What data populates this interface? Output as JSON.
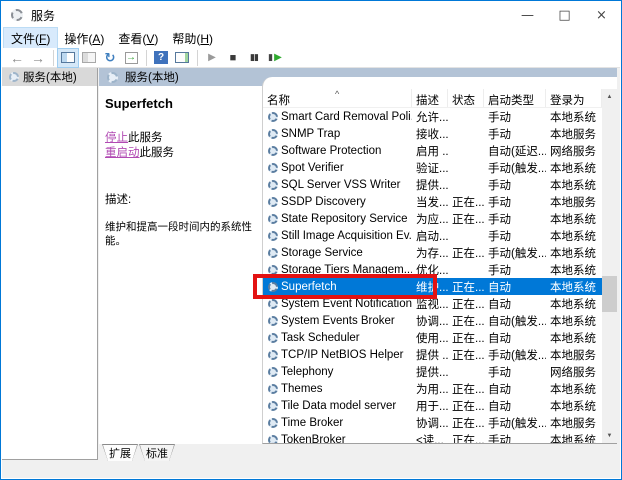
{
  "window": {
    "title": "服务"
  },
  "titlebar": {
    "minimize_glyph": "—",
    "maximize_glyph": "□",
    "close_glyph": "×"
  },
  "menu": {
    "items": [
      {
        "pre": "文件(",
        "key": "F",
        "post": ")",
        "hot": true
      },
      {
        "pre": "操作(",
        "key": "A",
        "post": ")",
        "hot": false
      },
      {
        "pre": "查看(",
        "key": "V",
        "post": ")",
        "hot": false
      },
      {
        "pre": "帮助(",
        "key": "H",
        "post": ")",
        "hot": false
      }
    ]
  },
  "toolbar": {
    "icons": [
      {
        "name": "back-icon",
        "type": "glyph",
        "glyph": "←",
        "cls": "arrow-g"
      },
      {
        "name": "forward-icon",
        "type": "glyph",
        "glyph": "→",
        "cls": "arrow-g"
      },
      {
        "name": "separator",
        "type": "sep"
      },
      {
        "name": "show-console-tree-icon",
        "type": "win",
        "cls": "win-ico",
        "pressed": true
      },
      {
        "name": "properties-icon",
        "type": "win",
        "cls": "win-ico gray",
        "pressed": false
      },
      {
        "name": "refresh-icon",
        "type": "glyph",
        "glyph": "↻",
        "cls": "refresh-g"
      },
      {
        "name": "export-list-icon",
        "type": "glyph",
        "glyph": "→",
        "cls": "export-g"
      },
      {
        "name": "separator",
        "type": "sep"
      },
      {
        "name": "help-icon",
        "type": "glyph",
        "glyph": "?",
        "cls": "help-g"
      },
      {
        "name": "show-action-pane-icon",
        "type": "win",
        "cls": "win-ico act",
        "pressed": false
      },
      {
        "name": "separator",
        "type": "sep"
      },
      {
        "name": "start-service-icon",
        "type": "glyph",
        "glyph": "▶",
        "cls": "start-g"
      },
      {
        "name": "stop-service-icon",
        "type": "glyph",
        "glyph": "■",
        "cls": "stop-g"
      },
      {
        "name": "pause-service-icon",
        "type": "glyph",
        "glyph": "▮▮",
        "cls": "pause-g"
      },
      {
        "name": "restart-service-icon",
        "type": "glyph",
        "glyph": "▶",
        "cls": "restart-g"
      }
    ]
  },
  "tree": {
    "items": [
      {
        "label": "服务(本地)"
      }
    ]
  },
  "pane_header": {
    "label": "服务(本地)"
  },
  "info": {
    "service_name": "Superfetch",
    "stop_link": "停止",
    "stop_suffix": "此服务",
    "restart_link": "重启动",
    "restart_suffix": "此服务",
    "description_label": "描述:",
    "description": "维护和提高一段时间内的系统性能。"
  },
  "table": {
    "columns": [
      "名称",
      "描述",
      "状态",
      "启动类型",
      "登录为"
    ],
    "sort_indicator": "^",
    "selected_index": 10,
    "rows": [
      {
        "name": "Smart Card Removal Poli...",
        "desc": "允许...",
        "status": "",
        "startup": "手动",
        "logon": "本地系统"
      },
      {
        "name": "SNMP Trap",
        "desc": "接收...",
        "status": "",
        "startup": "手动",
        "logon": "本地服务"
      },
      {
        "name": "Software Protection",
        "desc": "启用 ...",
        "status": "",
        "startup": "自动(延迟...",
        "logon": "网络服务"
      },
      {
        "name": "Spot Verifier",
        "desc": "验证...",
        "status": "",
        "startup": "手动(触发...",
        "logon": "本地系统"
      },
      {
        "name": "SQL Server VSS Writer",
        "desc": "提供...",
        "status": "",
        "startup": "手动",
        "logon": "本地系统"
      },
      {
        "name": "SSDP Discovery",
        "desc": "当发...",
        "status": "正在...",
        "startup": "手动",
        "logon": "本地服务"
      },
      {
        "name": "State Repository Service",
        "desc": "为应...",
        "status": "正在...",
        "startup": "手动",
        "logon": "本地系统"
      },
      {
        "name": "Still Image Acquisition Ev...",
        "desc": "启动...",
        "status": "",
        "startup": "手动",
        "logon": "本地系统"
      },
      {
        "name": "Storage Service",
        "desc": "为存...",
        "status": "正在...",
        "startup": "手动(触发...",
        "logon": "本地系统"
      },
      {
        "name": "Storage Tiers Managem...",
        "desc": "优化...",
        "status": "",
        "startup": "手动",
        "logon": "本地系统"
      },
      {
        "name": "Superfetch",
        "desc": "维护...",
        "status": "正在...",
        "startup": "自动",
        "logon": "本地系统"
      },
      {
        "name": "System Event Notification...",
        "desc": "监视...",
        "status": "正在...",
        "startup": "自动",
        "logon": "本地系统"
      },
      {
        "name": "System Events Broker",
        "desc": "协调...",
        "status": "正在...",
        "startup": "自动(触发...",
        "logon": "本地系统"
      },
      {
        "name": "Task Scheduler",
        "desc": "使用...",
        "status": "正在...",
        "startup": "自动",
        "logon": "本地系统"
      },
      {
        "name": "TCP/IP NetBIOS Helper",
        "desc": "提供 ...",
        "status": "正在...",
        "startup": "手动(触发...",
        "logon": "本地服务"
      },
      {
        "name": "Telephony",
        "desc": "提供...",
        "status": "",
        "startup": "手动",
        "logon": "网络服务"
      },
      {
        "name": "Themes",
        "desc": "为用...",
        "status": "正在...",
        "startup": "自动",
        "logon": "本地系统"
      },
      {
        "name": "Tile Data model server",
        "desc": "用于...",
        "status": "正在...",
        "startup": "自动",
        "logon": "本地系统"
      },
      {
        "name": "Time Broker",
        "desc": "协调...",
        "status": "正在...",
        "startup": "手动(触发...",
        "logon": "本地服务"
      },
      {
        "name": "TokenBroker",
        "desc": "<读...",
        "status": "正在...",
        "startup": "手动",
        "logon": "本地系统"
      }
    ]
  },
  "tabs": {
    "items": [
      "扩展",
      "标准"
    ],
    "active_index": 0
  },
  "colors": {
    "selection": "#0078d7",
    "annotation_red": "#e31212",
    "pane_header_bg": "#b3c3d6",
    "link_purple": "#b14ab3",
    "window_border": "#0078d7"
  }
}
